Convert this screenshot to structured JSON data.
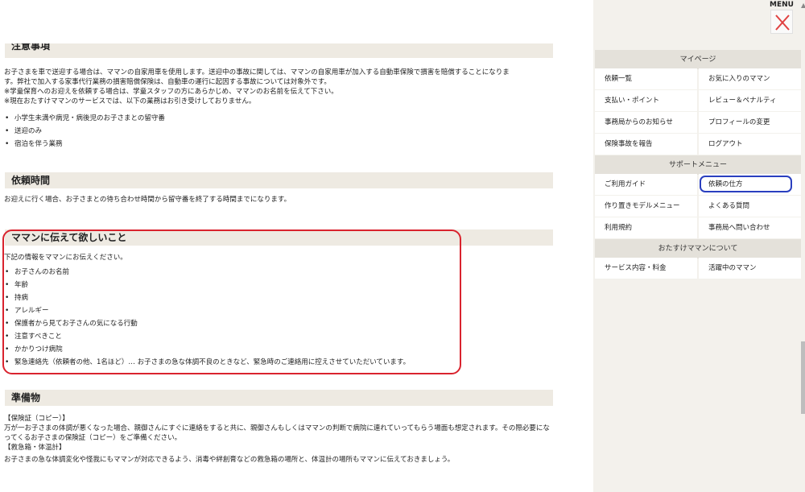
{
  "section1": {
    "heading": "注意事項",
    "lines": [
      "お子さまを車で送迎する場合は、ママンの自家用車を使用します。送迎中の事故に関しては、ママンの自家用車が加入する自動車保険で損害を賠償することになりま",
      "す。弊社で加入する家事代行業務の損害賠償保険は、自動車の運行に起因する事故については対象外です。",
      "※学童保育へのお迎えを依頼する場合は、学童スタッフの方にあらかじめ、ママンのお名前を伝えて下さい。",
      "※現在おたすけママンのサービスでは、以下の業務はお引き受けしておりません。"
    ],
    "items": [
      "小学生未満や病児・病後児のお子さまとの留守番",
      "送迎のみ",
      "宿泊を伴う業務"
    ]
  },
  "section2": {
    "heading": "依頼時間",
    "text": "お迎えに行く場合、お子さまとの待ち合わせ時間から留守番を終了する時間までになります。"
  },
  "section3": {
    "heading": "ママンに伝えて欲しいこと",
    "intro": "下記の情報をママンにお伝えください。",
    "items": [
      "お子さんのお名前",
      "年齢",
      "持病",
      "アレルギー",
      "保護者から見てお子さんの気になる行動",
      "注意すべきこと",
      "かかりつけ病院",
      "緊急連絡先（依頼者の他、1名ほど）… お子さまの急な体調不良のときなど、緊急時のご連絡用に控えさせていただいています。"
    ]
  },
  "section4": {
    "heading": "準備物",
    "sub1": "【保険証（コピー）】",
    "text1": "万が一お子さまの体調が悪くなった場合、親御さんにすぐに連絡をすると共に、親御さんもしくはママンの判断で病院に連れていってもらう場面も想定されます。その際必要になってくるお子さまの保険証（コピー）をご準備ください。",
    "sub2": "【救急箱・体温計】",
    "text2": "お子さまの急な体調変化や怪我にもママンが対応できるよう、消毒や絆創膏などの救急箱の場所と、体温計の場所もママンに伝えておきましょう。"
  },
  "sidebar": {
    "mypage_head": "マイページ",
    "mypage": [
      [
        "依頼一覧",
        "お気に入りのママン"
      ],
      [
        "支払い・ポイント",
        "レビュー＆ペナルティ"
      ],
      [
        "事務局からのお知らせ",
        "プロフィールの変更"
      ],
      [
        "保険事故を報告",
        "ログアウト"
      ]
    ],
    "support_head": "サポートメニュー",
    "support": [
      [
        "ご利用ガイド",
        "依頼の仕方"
      ],
      [
        "作り置きモデルメニュー",
        "よくある質問"
      ],
      [
        "利用規約",
        "事務局へ問い合わせ"
      ]
    ],
    "about_head": "おたすけママンについて",
    "about": [
      [
        "サービス内容・料金",
        "活躍中のママン"
      ]
    ]
  },
  "menu": {
    "label": "MENU"
  },
  "colors": {
    "highlight_red": "#d9232e",
    "highlight_blue": "#2a3fbf",
    "heading_bg": "#eeeae2",
    "close_x": "#e04040"
  }
}
